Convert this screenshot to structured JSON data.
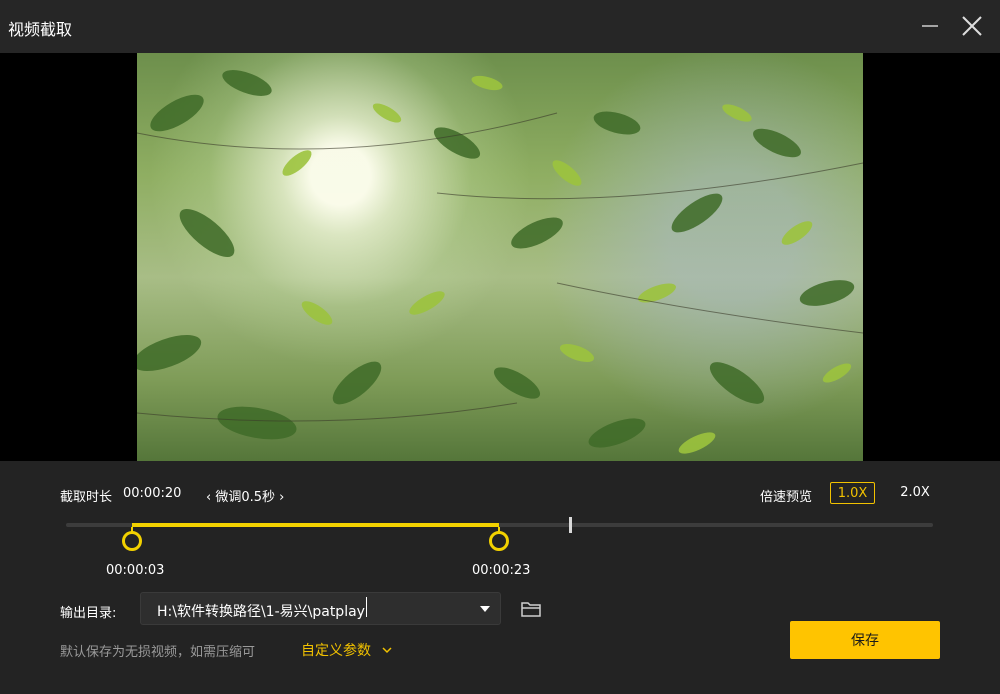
{
  "window": {
    "title": "视频截取",
    "minimize_icon": "minimize-icon",
    "close_icon": "close-icon"
  },
  "clip": {
    "duration_label": "截取时长",
    "duration_value": "00:00:20",
    "fine_tune_label": "微调0.5秒",
    "start_time": "00:00:03",
    "end_time": "00:00:23"
  },
  "speed_preview": {
    "label": "倍速预览",
    "options": [
      "1.0X",
      "2.0X"
    ],
    "selected": "1.0X"
  },
  "output": {
    "label": "输出目录:",
    "path": "H:\\软件转换路径\\1-易兴\\patplay",
    "folder_icon": "folder-icon"
  },
  "footer": {
    "hint": "默认保存为无损视频，如需压缩可",
    "custom_params_label": "自定义参数",
    "save_label": "保存"
  },
  "colors": {
    "accent": "#f2c200",
    "save_button": "#ffc400",
    "background": "#1f1f1f"
  }
}
